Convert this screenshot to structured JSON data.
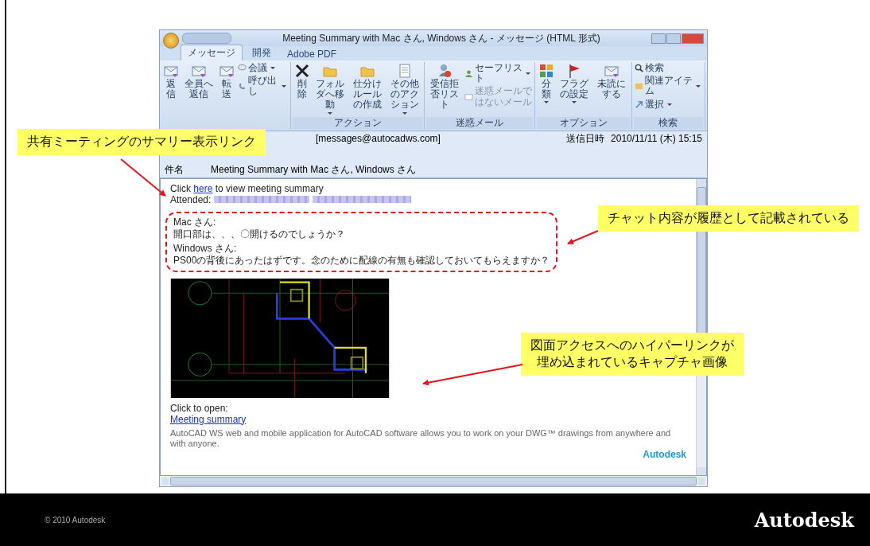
{
  "slide": {
    "callouts": [
      {
        "lines": [
          "共有ミーティングのサマリー表示リンク"
        ]
      },
      {
        "lines": [
          "チャット内容が履歴として記載されている"
        ]
      },
      {
        "lines": [
          "図面アクセスへのハイパーリンクが",
          "埋め込まれているキャプチャ画像"
        ]
      }
    ],
    "copyright": "© 2010 Autodesk",
    "logo": "Autodesk"
  },
  "window": {
    "title": "Meeting Summary with Mac さん, Windows さん - メッセージ (HTML 形式)",
    "tabs": [
      {
        "label": "メッセージ",
        "selected": true
      },
      {
        "label": "開発",
        "selected": false
      },
      {
        "label": "Adobe PDF",
        "selected": false
      }
    ],
    "ribbon": [
      {
        "items": [
          {
            "label": "返信",
            "kind": "large",
            "disabled": false,
            "menu": false
          },
          {
            "label": "全員へ返信",
            "kind": "large",
            "disabled": false,
            "menu": false
          },
          {
            "label": "転送",
            "kind": "large",
            "disabled": false,
            "menu": false
          },
          {
            "label": "会議",
            "kind": "small",
            "disabled": false,
            "menu": true
          },
          {
            "label": "呼び出し",
            "kind": "small",
            "disabled": false,
            "menu": true
          }
        ]
      },
      {
        "label": "アクション",
        "items": [
          {
            "label": "削除",
            "kind": "large",
            "disabled": false,
            "menu": false
          },
          {
            "label": "フォルダへ移動",
            "kind": "large",
            "disabled": false,
            "menu": true
          },
          {
            "label": "仕分けルールの作成",
            "kind": "large",
            "disabled": false,
            "menu": false
          },
          {
            "label": "その他のアクション",
            "kind": "large",
            "disabled": false,
            "menu": true
          }
        ]
      },
      {
        "label": "迷惑メール",
        "items": [
          {
            "label": "受信拒否リスト",
            "kind": "large",
            "disabled": false,
            "menu": false
          },
          {
            "label": "セーフリスト",
            "kind": "small",
            "disabled": false,
            "menu": true
          },
          {
            "label": "迷惑メールではないメール",
            "kind": "small",
            "disabled": true,
            "menu": false
          }
        ]
      },
      {
        "label": "オプション",
        "items": [
          {
            "label": "分類",
            "kind": "large",
            "disabled": false,
            "menu": true
          },
          {
            "label": "フラグの設定",
            "kind": "large",
            "disabled": false,
            "menu": true
          },
          {
            "label": "未読にする",
            "kind": "large",
            "disabled": false,
            "menu": false
          }
        ]
      },
      {
        "label": "検索",
        "items": [
          {
            "label": "検索",
            "kind": "small",
            "disabled": false,
            "menu": false
          },
          {
            "label": "関連アイテム",
            "kind": "small",
            "disabled": false,
            "menu": true
          },
          {
            "label": "選択",
            "kind": "small",
            "disabled": false,
            "menu": true
          }
        ]
      }
    ],
    "header": {
      "from": "[messages@autocadws.com]",
      "sent_label": "送信日時",
      "sent": "2010/11/11 (木) 15:15",
      "subject_label": "件名",
      "subject": "Meeting Summary with Mac さん, Windows さん"
    },
    "body": {
      "intro_before": "Click",
      "link": "here",
      "intro_after": "to view meeting summary",
      "attended_label": "Attended:",
      "chat": [
        {
          "speaker": "Mac さん:",
          "message": "開口部は、、、〇開けるのでしょうか？"
        },
        {
          "speaker": "Windows さん:",
          "message": "PS00の背後にあったはずです。念のために配線の有無も確認しておいてもらえますか？"
        }
      ],
      "caption": "Click to open:",
      "open_link": "Meeting summary",
      "disclaimer": "AutoCAD WS web and mobile application for AutoCAD software allows you to work on your DWG™ drawings from anywhere and with anyone.",
      "brand": "Autodesk"
    }
  }
}
